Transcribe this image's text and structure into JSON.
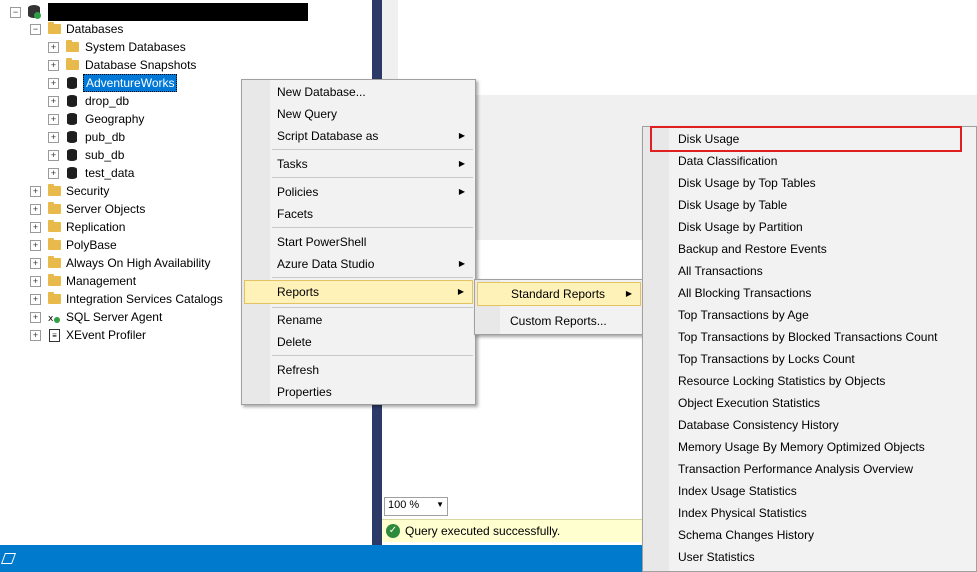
{
  "explorer": {
    "databases_label": "Databases",
    "items": [
      {
        "label": "System Databases",
        "icon": "folder-icon"
      },
      {
        "label": "Database Snapshots",
        "icon": "folder-icon"
      },
      {
        "label": "AdventureWorks",
        "icon": "database-icon"
      },
      {
        "label": "drop_db",
        "icon": "database-icon"
      },
      {
        "label": "Geography",
        "icon": "database-icon"
      },
      {
        "label": "pub_db",
        "icon": "database-icon"
      },
      {
        "label": "sub_db",
        "icon": "database-icon"
      },
      {
        "label": "test_data",
        "icon": "database-icon"
      }
    ],
    "top_items": [
      {
        "label": "Security"
      },
      {
        "label": "Server Objects"
      },
      {
        "label": "Replication"
      },
      {
        "label": "PolyBase"
      },
      {
        "label": "Always On High Availability"
      },
      {
        "label": "Management"
      },
      {
        "label": "Integration Services Catalogs"
      },
      {
        "label": "SQL Server Agent"
      },
      {
        "label": "XEvent Profiler"
      }
    ]
  },
  "context_menu": {
    "new_database": "New Database...",
    "new_query": "New Query",
    "script_database_as": "Script Database as",
    "tasks": "Tasks",
    "policies": "Policies",
    "facets": "Facets",
    "start_powershell": "Start PowerShell",
    "azure_data_studio": "Azure Data Studio",
    "reports": "Reports",
    "rename": "Rename",
    "delete": "Delete",
    "refresh": "Refresh",
    "properties": "Properties"
  },
  "reports_menu": {
    "standard_reports": "Standard Reports",
    "custom_reports": "Custom Reports..."
  },
  "standard_reports": [
    "Disk Usage",
    "Data Classification",
    "Disk Usage by Top Tables",
    "Disk Usage by Table",
    "Disk Usage by Partition",
    "Backup and Restore Events",
    "All Transactions",
    "All Blocking Transactions",
    "Top Transactions by Age",
    "Top Transactions by Blocked Transactions Count",
    "Top Transactions by Locks Count",
    "Resource Locking Statistics by Objects",
    "Object Execution Statistics",
    "Database Consistency History",
    "Memory Usage By Memory Optimized Objects",
    "Transaction Performance Analysis Overview",
    "Index Usage Statistics",
    "Index Physical Statistics",
    "Schema Changes History",
    "User Statistics"
  ],
  "query": {
    "zoom": "100 %",
    "status": "Query executed successfully."
  },
  "colors": {
    "highlight": "#fff2b8",
    "selection": "#0078d7",
    "red_outline": "#e02020",
    "taskbar": "#007acc"
  }
}
